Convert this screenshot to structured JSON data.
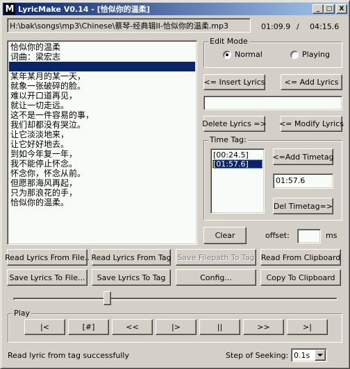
{
  "window": {
    "app_icon_letter": "M",
    "title": "LyricMake V0.14 - [恰似你的温柔]",
    "minimize_glyph": "_",
    "maximize_glyph": "□",
    "close_glyph": "X"
  },
  "header": {
    "filepath": "H:\\bak\\songs\\mp3\\Chinese\\蔡琴-经典辑II-恰似你的温柔.mp3",
    "current_time": "01:09.9",
    "separator": "/",
    "total_time": "04:15.6"
  },
  "lyrics": {
    "lines": [
      {
        "text": "恰似你的温柔",
        "selected": false
      },
      {
        "text": "词曲：梁宏志",
        "selected": false
      },
      {
        "text": "",
        "selected": true
      },
      {
        "text": "某年某月的某一天，",
        "selected": false
      },
      {
        "text": "就象一张破碎的脸。",
        "selected": false
      },
      {
        "text": "难以开口道再见，",
        "selected": false
      },
      {
        "text": "就让一切走远。",
        "selected": false
      },
      {
        "text": "这不是一件容易的事，",
        "selected": false
      },
      {
        "text": "我们却都没有哭泣。",
        "selected": false
      },
      {
        "text": "让它淡淡地来，",
        "selected": false
      },
      {
        "text": "让它好好地去。",
        "selected": false
      },
      {
        "text": "到如今年复一年，",
        "selected": false
      },
      {
        "text": "我不能停止怀念。",
        "selected": false
      },
      {
        "text": "怀念你，怀念从前。",
        "selected": false
      },
      {
        "text": "但愿那海风再起，",
        "selected": false
      },
      {
        "text": "只为那浪花的手，",
        "selected": false
      },
      {
        "text": "恰似你的温柔。",
        "selected": false
      }
    ]
  },
  "edit_mode": {
    "label": "Edit Mode",
    "options": [
      {
        "label": "Normal",
        "checked": true
      },
      {
        "label": "Playing",
        "checked": false
      }
    ]
  },
  "lyric_buttons": {
    "insert": "<= Insert Lyrics",
    "add": "<= Add Lyrics",
    "delete": "Delete Lyrics =>",
    "modify": "<= Modify Lyrics"
  },
  "lyric_input": {
    "value": ""
  },
  "time_tag": {
    "label": "Time Tag:",
    "items": [
      {
        "text": "[00:24.5]",
        "selected": false
      },
      {
        "text": "[01:57.6]",
        "selected": true
      }
    ],
    "add_button": "<=Add Timetag",
    "value": "01:57.6",
    "del_button": "Del Timetag=>"
  },
  "offset": {
    "clear_button": "Clear",
    "label": "offset:",
    "value": "",
    "unit": "ms"
  },
  "actions": {
    "read_from_file": "Read Lyrics From File..",
    "read_from_tag": "Read Lyrics From Tag",
    "save_filepath_to_tag": "Save Filepath To Tag",
    "read_from_clipboard": "Read From Clipboard",
    "save_to_file": "Save Lyrics To File...",
    "save_to_tag": "Save Lyrics To Tag",
    "config": "Config...",
    "copy_to_clipboard": "Copy To Clipboard"
  },
  "seek": {
    "position_fraction": 0.29
  },
  "play": {
    "label": "Play",
    "buttons": [
      "|<",
      "[#]",
      "<<",
      "|>",
      "||",
      ">>",
      ">|"
    ]
  },
  "status": {
    "message": "Read lyric from tag successfully",
    "step_label": "Step of Seeking:",
    "step_value": "0.1s"
  }
}
